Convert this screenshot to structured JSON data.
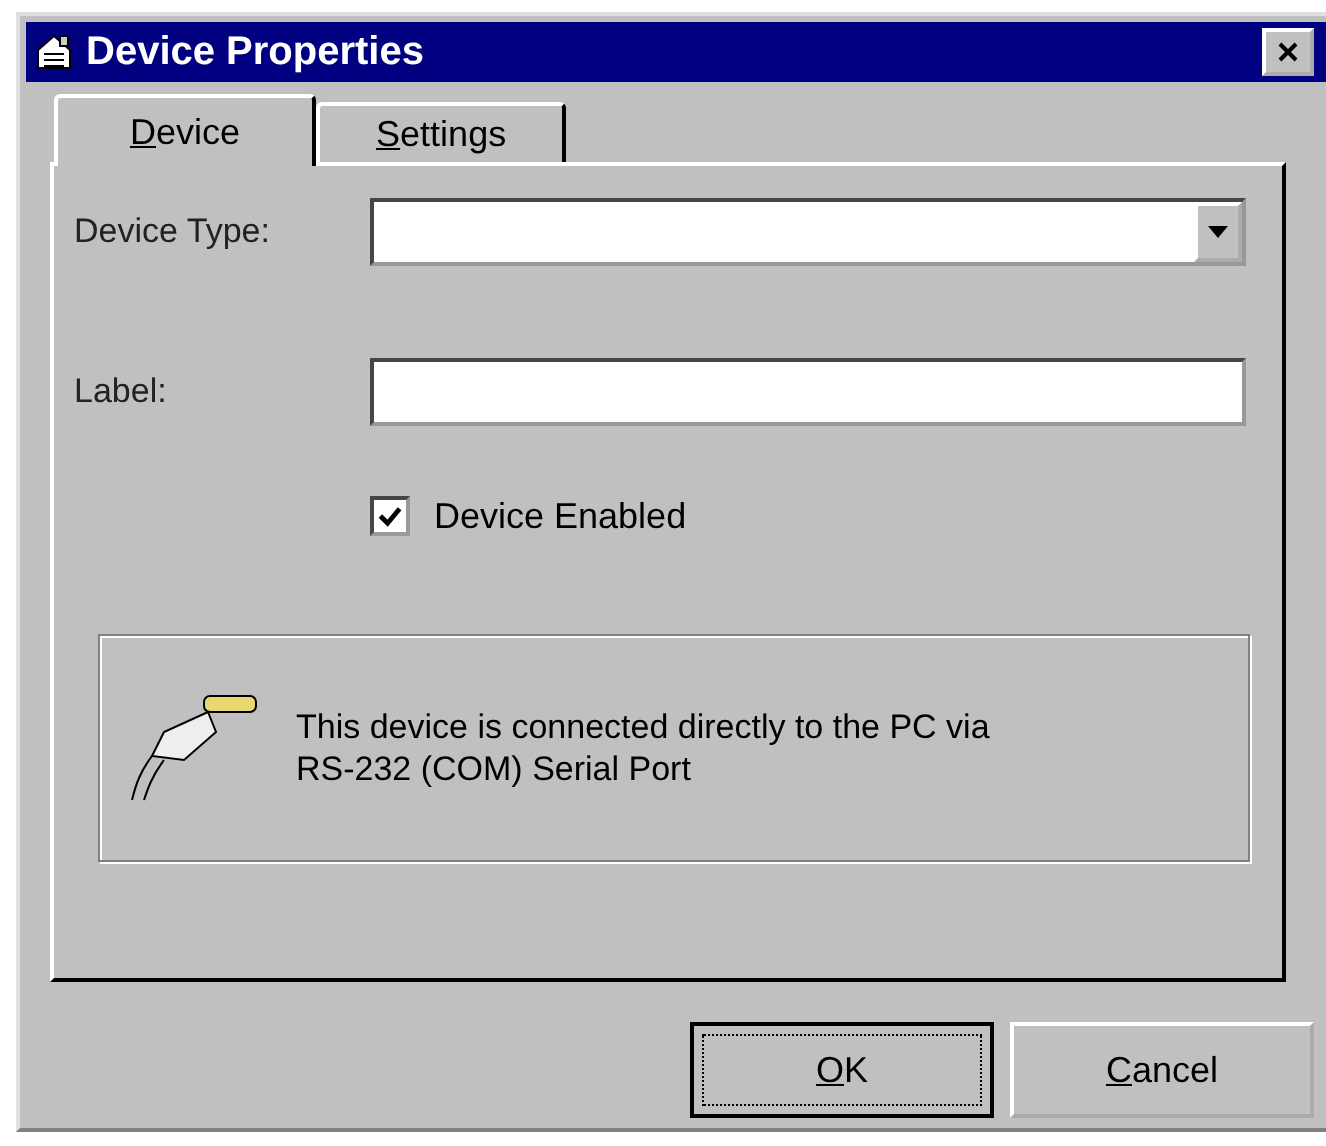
{
  "window": {
    "title": "Device Properties"
  },
  "tabs": [
    {
      "accel": "D",
      "rest": "evice",
      "selected": true
    },
    {
      "accel": "S",
      "rest": "ettings",
      "selected": false
    }
  ],
  "fields": [
    {
      "kind": "combo",
      "label": "Device Type:"
    },
    {
      "kind": "text",
      "label": "Label:"
    }
  ],
  "checkbox": {
    "label": "Device Enabled",
    "checked": true
  },
  "info": {
    "text": "This device is connected directly to the PC via RS-232 (COM) Serial Port"
  },
  "buttons": [
    {
      "accel": "O",
      "rest": "K",
      "default": true
    },
    {
      "accel": "C",
      "rest": "ancel",
      "default": false
    }
  ]
}
